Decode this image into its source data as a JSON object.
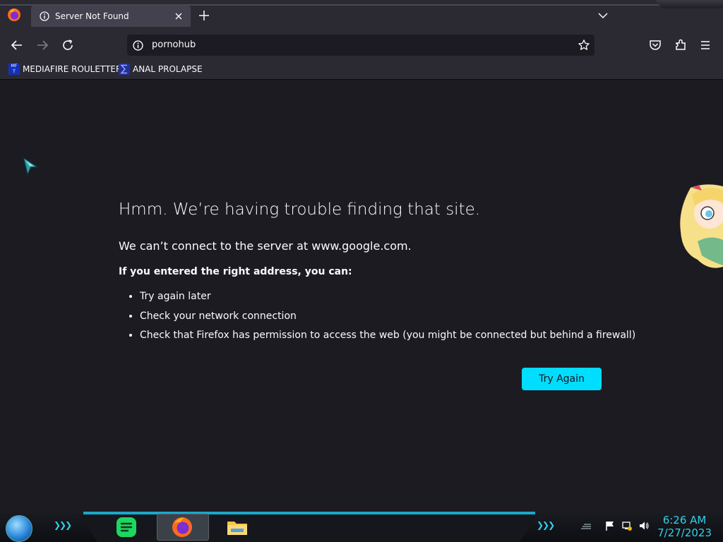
{
  "tab": {
    "title": "Server Not Found"
  },
  "urlbar": {
    "value": "pornohub"
  },
  "bookmarks": [
    {
      "label": "MEDIAFIRE ROULETTER",
      "favicon_text": "MF T"
    },
    {
      "label": "ANAL PROLAPSE"
    }
  ],
  "error": {
    "title": "Hmm. We’re having trouble finding that site.",
    "message": "We can’t connect to the server at www.google.com.",
    "suggestion_heading": "If you entered the right address, you can:",
    "suggestions": [
      "Try again later",
      "Check your network connection",
      "Check that Firefox has permission to access the web (you might be connected but behind a firewall)"
    ],
    "button_label": "Try Again"
  },
  "taskbar": {
    "time": "6:26 AM",
    "date": "7/27/2023"
  },
  "colors": {
    "page_bg": "#1c1b22",
    "toolbar_bg": "#2b2a33",
    "accent": "#00ddff",
    "taskbar_accent": "#1ba7c9"
  }
}
